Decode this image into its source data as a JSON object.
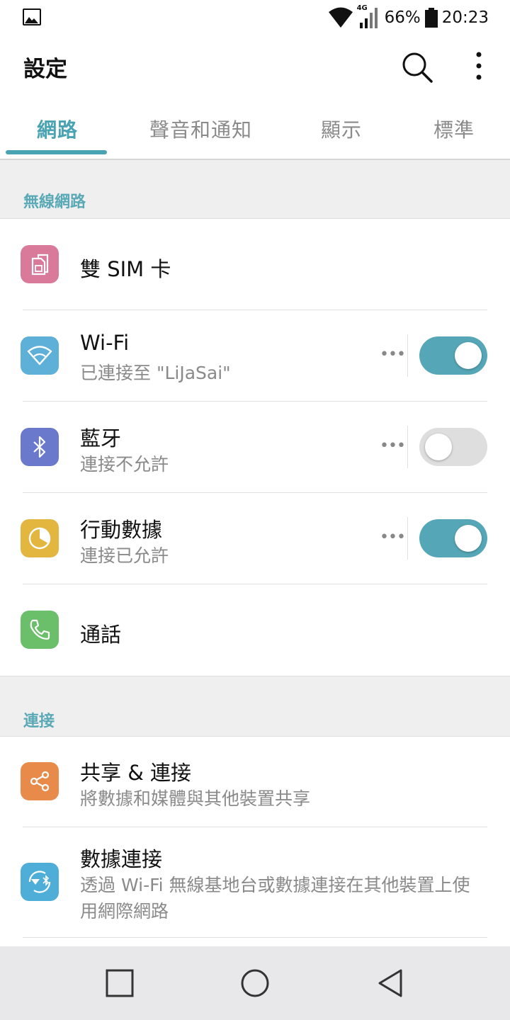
{
  "status_bar": {
    "network_type": "4G",
    "battery": "66%",
    "time": "20:23"
  },
  "app_bar": {
    "title": "設定"
  },
  "tabs": [
    {
      "label": "網路",
      "active": true
    },
    {
      "label": "聲音和通知",
      "active": false
    },
    {
      "label": "顯示",
      "active": false
    },
    {
      "label": "標準",
      "active": false
    }
  ],
  "sections": {
    "wireless": {
      "header": "無線網路",
      "items": [
        {
          "title": "雙 SIM 卡",
          "icon": "sim-card-icon",
          "color": "#d97a9b"
        },
        {
          "title": "Wi-Fi",
          "subtitle": "已連接至 \"LiJaSai\"",
          "icon": "wifi-icon",
          "color": "#5eb0d9",
          "more": "•••",
          "toggle": true
        },
        {
          "title": "藍牙",
          "subtitle": "連接不允許",
          "icon": "bluetooth-icon",
          "color": "#6b79cc",
          "more": "•••",
          "toggle": false
        },
        {
          "title": "行動數據",
          "subtitle": "連接已允許",
          "icon": "mobile-data-icon",
          "color": "#e3b63f",
          "more": "•••",
          "toggle": true
        },
        {
          "title": "通話",
          "icon": "phone-icon",
          "color": "#6cbf6a"
        }
      ]
    },
    "connect": {
      "header": "連接",
      "items": [
        {
          "title": "共享 & 連接",
          "subtitle": "將數據和媒體與其他裝置共享",
          "icon": "share-icon",
          "color": "#e88b4a"
        },
        {
          "title": "數據連接",
          "subtitle": "透過 Wi-Fi 無線基地台或數據連接在其他裝置上使用網際網路",
          "icon": "tethering-icon",
          "color": "#4eaed8"
        }
      ]
    }
  },
  "nav_bar": {
    "buttons": [
      "recents-icon",
      "home-icon",
      "back-icon"
    ]
  }
}
